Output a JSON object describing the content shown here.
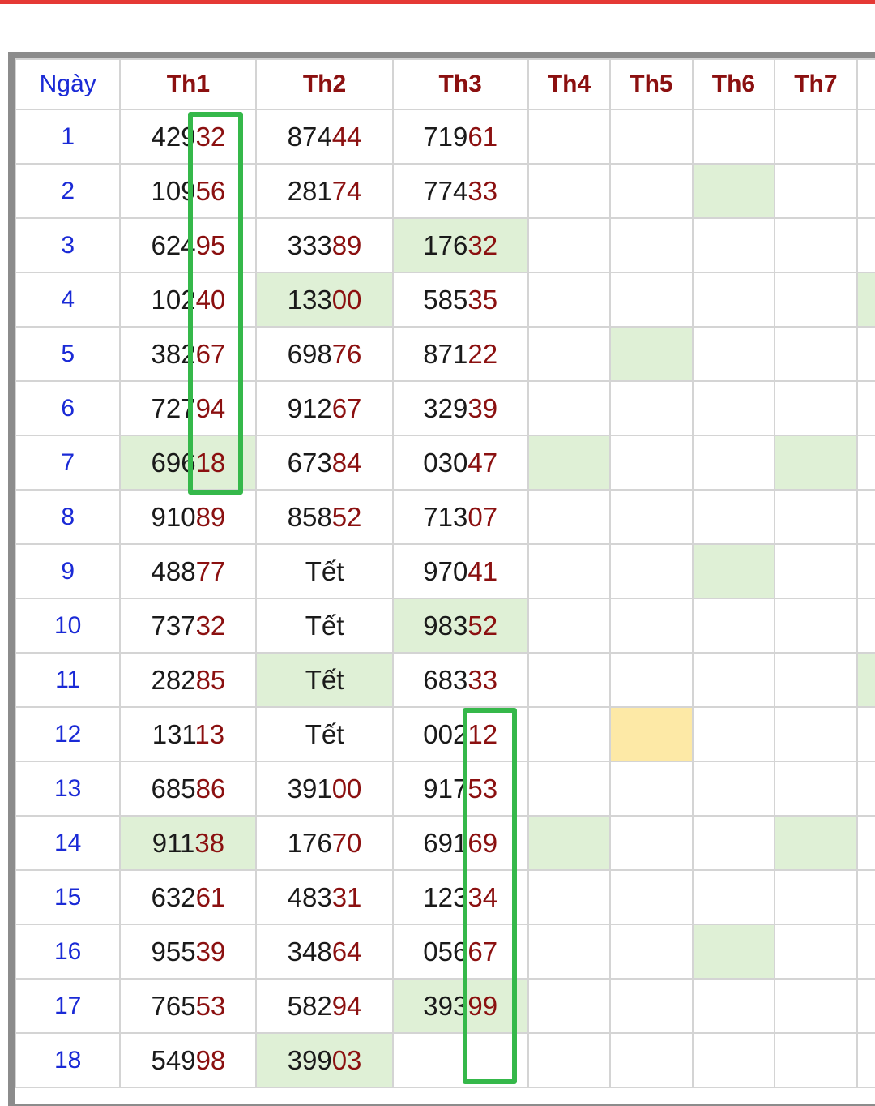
{
  "header": {
    "day_label": "Ngày",
    "months": [
      "Th1",
      "Th2",
      "Th3",
      "Th4",
      "Th5",
      "Th6",
      "Th7"
    ]
  },
  "colors": {
    "top_bar": "#e53935",
    "day_text": "#1a2ad6",
    "month_header_text": "#8b1010",
    "last_two_digits": "#8b1010",
    "highlight_cell": "#dff0d6",
    "marked_cell": "#fde9a6",
    "annotation_box": "#35b84a"
  },
  "rows": [
    {
      "day": "1",
      "cells": [
        "42932",
        "87444",
        "71961",
        "",
        "",
        "",
        ""
      ]
    },
    {
      "day": "2",
      "cells": [
        "10956",
        "28174",
        "77433",
        "",
        "",
        "",
        ""
      ]
    },
    {
      "day": "3",
      "cells": [
        "62495",
        "33389",
        "17632",
        "",
        "",
        "",
        ""
      ]
    },
    {
      "day": "4",
      "cells": [
        "10240",
        "13300",
        "58535",
        "",
        "",
        "",
        ""
      ]
    },
    {
      "day": "5",
      "cells": [
        "38267",
        "69876",
        "87122",
        "",
        "",
        "",
        ""
      ]
    },
    {
      "day": "6",
      "cells": [
        "72794",
        "91267",
        "32939",
        "",
        "",
        "",
        ""
      ]
    },
    {
      "day": "7",
      "cells": [
        "69618",
        "67384",
        "03047",
        "",
        "",
        "",
        ""
      ]
    },
    {
      "day": "8",
      "cells": [
        "91089",
        "85852",
        "71307",
        "",
        "",
        "",
        ""
      ]
    },
    {
      "day": "9",
      "cells": [
        "48877",
        "Tết",
        "97041",
        "",
        "",
        "",
        ""
      ]
    },
    {
      "day": "10",
      "cells": [
        "73732",
        "Tết",
        "98352",
        "",
        "",
        "",
        ""
      ]
    },
    {
      "day": "11",
      "cells": [
        "28285",
        "Tết",
        "68333",
        "",
        "",
        "",
        ""
      ]
    },
    {
      "day": "12",
      "cells": [
        "13113",
        "Tết",
        "00212",
        "",
        "",
        "",
        ""
      ]
    },
    {
      "day": "13",
      "cells": [
        "68586",
        "39100",
        "91753",
        "",
        "",
        "",
        ""
      ]
    },
    {
      "day": "14",
      "cells": [
        "91138",
        "17670",
        "69169",
        "",
        "",
        "",
        ""
      ]
    },
    {
      "day": "15",
      "cells": [
        "63261",
        "48331",
        "12334",
        "",
        "",
        "",
        ""
      ]
    },
    {
      "day": "16",
      "cells": [
        "95539",
        "34864",
        "05667",
        "",
        "",
        "",
        ""
      ]
    },
    {
      "day": "17",
      "cells": [
        "76553",
        "58294",
        "39399",
        "",
        "",
        "",
        ""
      ]
    },
    {
      "day": "18",
      "cells": [
        "54998",
        "39903",
        "",
        "",
        "",
        "",
        ""
      ]
    }
  ]
}
